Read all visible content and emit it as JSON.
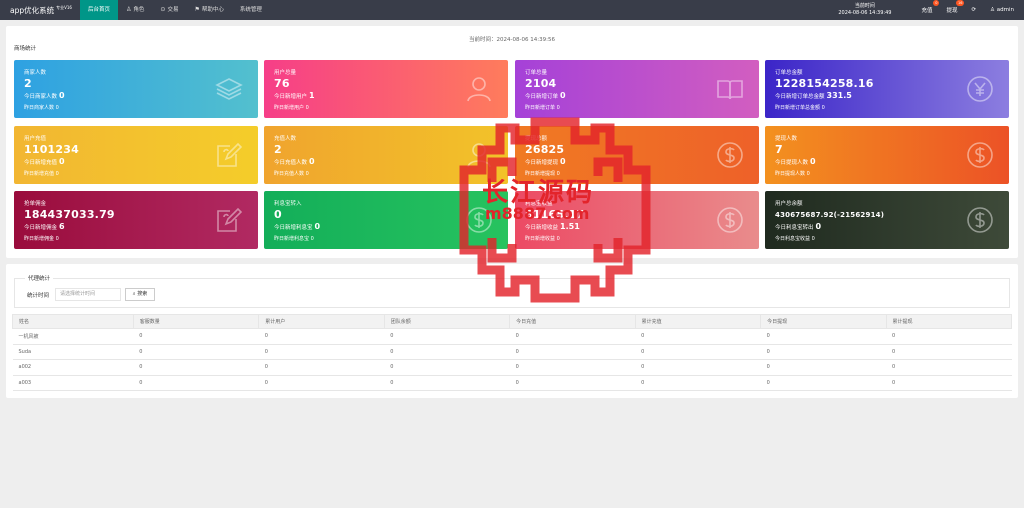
{
  "app": {
    "title": "app优化系统",
    "version": "专业V16"
  },
  "nav": [
    "后台首页",
    "角色",
    "交易",
    "帮助中心",
    "系统管理"
  ],
  "header": {
    "time_label": "当前时间",
    "time_value": "2024-08-06 14:39:49",
    "recharge": "充值",
    "recharge_badge": "0",
    "withdraw": "提现",
    "withdraw_badge": "16",
    "user": "admin"
  },
  "stats": {
    "current_time": "当前时间：2024-08-06 14:39:56",
    "title": "商场统计",
    "cards": [
      {
        "label": "商家人数",
        "value": "2",
        "today_label": "今日商家人数",
        "today_value": "0",
        "yesterday": "昨日商家人数 0",
        "icon": "layers-icon"
      },
      {
        "label": "用户总量",
        "value": "76",
        "today_label": "今日新增用户",
        "today_value": "1",
        "yesterday": "昨日新增用户 0",
        "icon": "user-icon"
      },
      {
        "label": "订单总量",
        "value": "2104",
        "today_label": "今日新增订单",
        "today_value": "0",
        "yesterday": "昨日新增订单 0",
        "icon": "book-icon"
      },
      {
        "label": "订单总金额",
        "value": "1228154258.16",
        "today_label": "今日新增订单总金额",
        "today_value": "331.5",
        "yesterday": "昨日新增订单总金额 0",
        "icon": "yen-icon"
      },
      {
        "label": "用户充值",
        "value": "1101234",
        "today_label": "今日新增充值",
        "today_value": "0",
        "yesterday": "昨日新增充值 0",
        "icon": "edit-icon"
      },
      {
        "label": "充值人数",
        "value": "2",
        "today_label": "今日充值人数",
        "today_value": "0",
        "yesterday": "昨日充值人数 0",
        "icon": "user-icon"
      },
      {
        "label": "提现总额",
        "value": "26825",
        "today_label": "今日新增提现",
        "today_value": "0",
        "yesterday": "昨日新增提现 0",
        "icon": "dollar-icon"
      },
      {
        "label": "提现人数",
        "value": "7",
        "today_label": "今日提现人数",
        "today_value": "0",
        "yesterday": "昨日提现人数 0",
        "icon": "dollar-icon"
      },
      {
        "label": "抢单佣金",
        "value": "184437033.79",
        "today_label": "今日新增佣金",
        "today_value": "6",
        "yesterday": "昨日新增佣金 0",
        "icon": "edit-icon"
      },
      {
        "label": "利息宝转入",
        "value": "0",
        "today_label": "今日新增利息宝",
        "today_value": "0",
        "yesterday": "昨日新增利息宝 0",
        "icon": "dollar-icon"
      },
      {
        "label": "利息宝收益",
        "value": "81165.17",
        "today_label": "今日新增收益",
        "today_value": "1.51",
        "yesterday": "昨日新增收益 0",
        "icon": "dollar-icon"
      },
      {
        "label": "用户总余额",
        "value": "430675687.92(-21562914)",
        "today_label": "今日利息宝转出",
        "today_value": "0",
        "yesterday": "今日利息宝收益 0",
        "icon": "dollar-icon"
      }
    ]
  },
  "agent": {
    "legend": "代理统计",
    "filter_label": "统计时间",
    "filter_placeholder": "请选择统计时间",
    "search_btn": "搜索",
    "columns": [
      "姓名",
      "客服数量",
      "累计用户",
      "团队余额",
      "今日充值",
      "累计充值",
      "今日提现",
      "累计提现"
    ],
    "rows": [
      [
        "一机风被",
        "0",
        "0",
        "0",
        "0",
        "0",
        "0",
        "0"
      ],
      [
        "Suda",
        "0",
        "0",
        "0",
        "0",
        "0",
        "0",
        "0"
      ],
      [
        "a002",
        "0",
        "0",
        "0",
        "0",
        "0",
        "0",
        "0"
      ],
      [
        "a003",
        "0",
        "0",
        "0",
        "0",
        "0",
        "0",
        "0"
      ]
    ]
  },
  "watermark": {
    "text": "长江源码",
    "url": "m8887.com"
  }
}
